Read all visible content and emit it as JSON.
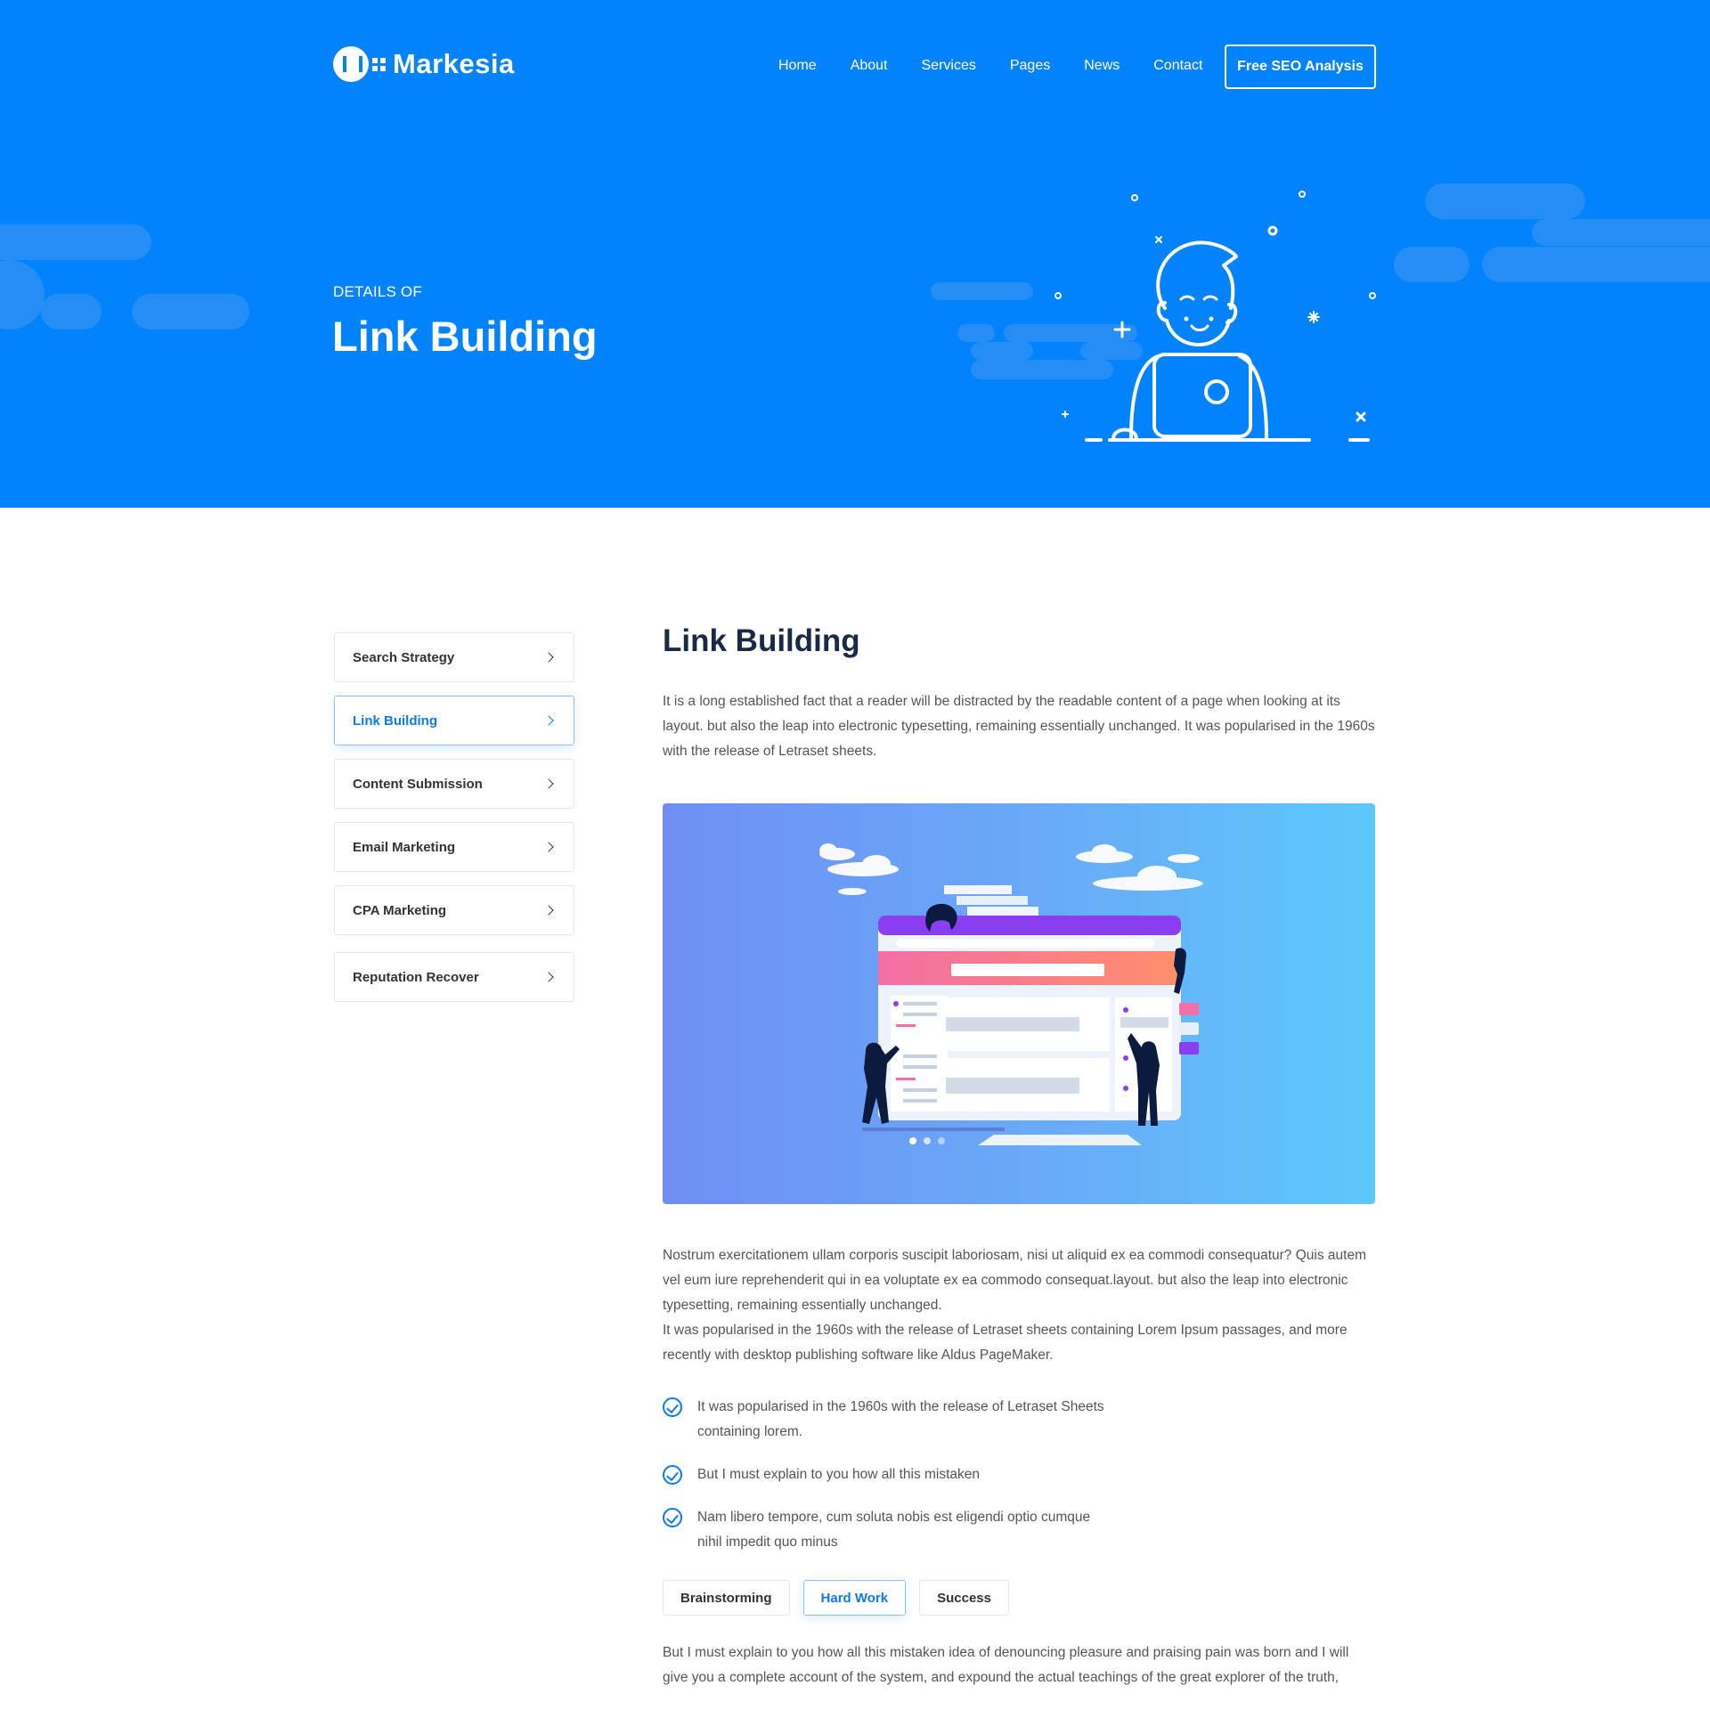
{
  "brand": {
    "name": "Markesia"
  },
  "nav": {
    "items": [
      "Home",
      "About",
      "Services",
      "Pages",
      "News",
      "Contact"
    ],
    "cta": "Free SEO Analysis"
  },
  "hero": {
    "subtitle": "DETAILS OF",
    "title": "Link Building"
  },
  "sidebar": {
    "items": [
      {
        "label": "Search Strategy",
        "active": false
      },
      {
        "label": "Link Building",
        "active": true
      },
      {
        "label": "Content Submission",
        "active": false
      },
      {
        "label": "Email Marketing",
        "active": false
      },
      {
        "label": "CPA Marketing",
        "active": false
      },
      {
        "label": "Reputation Recover",
        "active": false
      }
    ]
  },
  "main": {
    "title": "Link Building",
    "intro": "It is a long established fact that a reader will be distracted by the readable content of a page when looking at its layout.  but also the leap into electronic typesetting, remaining essentially unchanged. It was popularised in the 1960s with the release of Letraset sheets.",
    "para1": "Nostrum exercitationem ullam corporis suscipit laboriosam, nisi ut aliquid ex ea commodi consequatur? Quis autem vel eum iure reprehenderit qui in ea voluptate  ex ea commodo consequat.layout.  but also the leap into electronic typesetting, remaining essentially unchanged.",
    "para2": "It was popularised in the 1960s with the release of Letraset sheets containing Lorem Ipsum passages, and more recently with desktop publishing software like Aldus PageMaker.",
    "checks": [
      "It was popularised in the 1960s with the release of Letraset Sheets containing lorem.",
      "But I must explain to you how all this mistaken",
      " Nam libero tempore, cum soluta nobis est eligendi optio cumque nihil impedit quo minus"
    ],
    "tabs": [
      {
        "label": "Brainstorming",
        "active": false
      },
      {
        "label": "Hard Work",
        "active": true
      },
      {
        "label": "Success",
        "active": false
      }
    ],
    "closing": "But I must explain to you how all this mistaken idea of denouncing pleasure and praising pain was born and I will give you a complete account of the system, and expound the actual teachings of the great explorer of the truth,"
  },
  "colors": {
    "hero": "#0282fb",
    "accent": "#0f79e8",
    "heading": "#1a2a44"
  }
}
